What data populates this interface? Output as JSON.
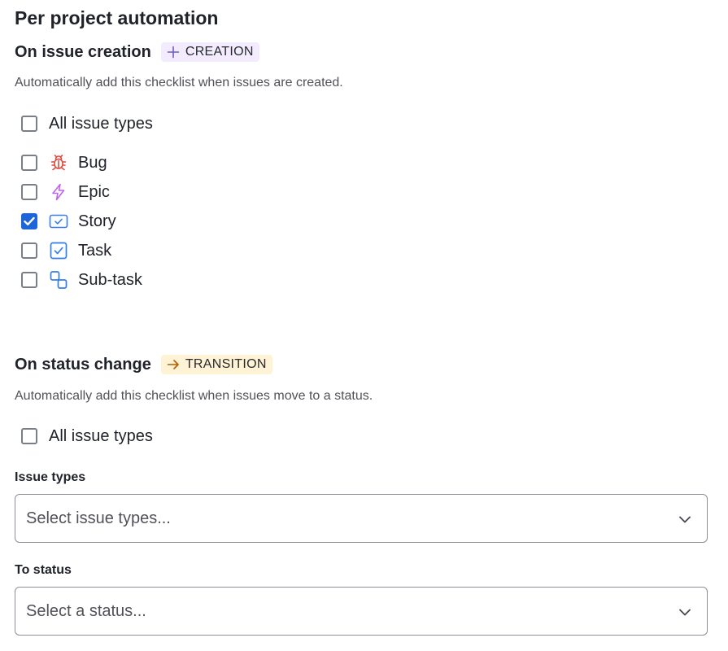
{
  "page_title": "Per project automation",
  "creation": {
    "title": "On issue creation",
    "badge": "CREATION",
    "badge_icon": "plus-icon",
    "description": "Automatically add this checklist when issues are created.",
    "all_types": {
      "label": "All issue types",
      "checked": false
    },
    "issue_types": [
      {
        "label": "Bug",
        "icon": "bug-icon",
        "color": "#e2483d",
        "checked": false
      },
      {
        "label": "Epic",
        "icon": "lightning-icon",
        "color": "#bf63f3",
        "checked": false
      },
      {
        "label": "Story",
        "icon": "story-icon",
        "color": "#357de8",
        "checked": true
      },
      {
        "label": "Task",
        "icon": "task-icon",
        "color": "#357de8",
        "checked": false
      },
      {
        "label": "Sub-task",
        "icon": "subtask-icon",
        "color": "#357de8",
        "checked": false
      }
    ]
  },
  "transition": {
    "title": "On status change",
    "badge": "TRANSITION",
    "badge_icon": "arrow-right-icon",
    "description": "Automatically add this checklist when issues move to a status.",
    "all_types": {
      "label": "All issue types",
      "checked": false
    },
    "issue_types_field": {
      "label": "Issue types",
      "placeholder": "Select issue types..."
    },
    "to_status_field": {
      "label": "To status",
      "placeholder": "Select a status..."
    }
  },
  "colors": {
    "accent": "#1d65d8",
    "creation_badge_bg": "#f3ecfe",
    "transition_badge_bg": "#fff3d6",
    "transition_badge_icon": "#b65c02"
  }
}
